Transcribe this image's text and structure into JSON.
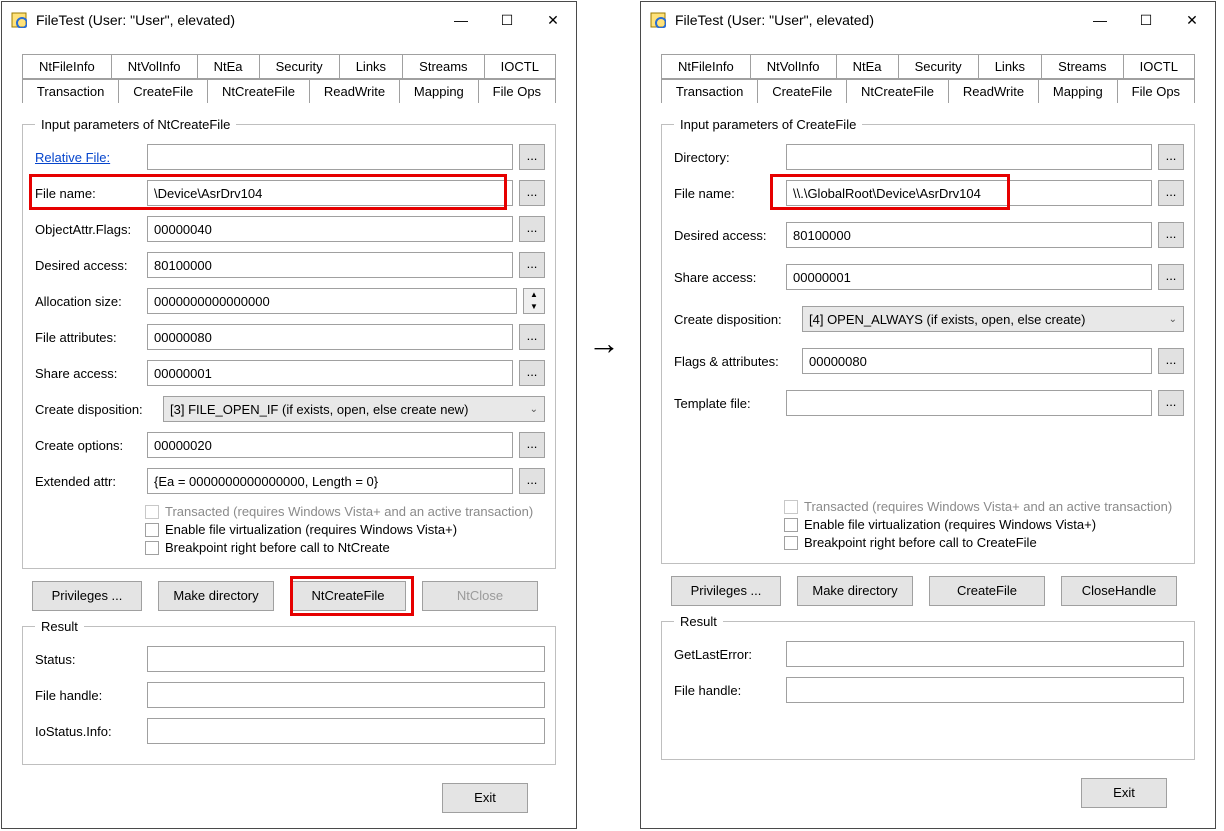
{
  "arrow": "→",
  "left": {
    "title": "FileTest (User: \"User\", elevated)",
    "tabs_row1": [
      "NtFileInfo",
      "NtVolInfo",
      "NtEa",
      "Security",
      "Links",
      "Streams",
      "IOCTL"
    ],
    "tabs_row2": [
      "Transaction",
      "CreateFile",
      "NtCreateFile",
      "ReadWrite",
      "Mapping",
      "File Ops"
    ],
    "active_tab": "NtCreateFile",
    "fieldset_title": "Input parameters of NtCreateFile",
    "labels": {
      "relative_file": "Relative File:",
      "file_name": "File name:",
      "object_flags": "ObjectAttr.Flags:",
      "desired_access": "Desired access:",
      "allocation_size": "Allocation size:",
      "file_attributes": "File attributes:",
      "share_access": "Share access:",
      "create_disposition": "Create disposition:",
      "create_options": "Create options:",
      "extended_attr": "Extended attr:"
    },
    "values": {
      "relative_file": "",
      "file_name": "\\Device\\AsrDrv104",
      "object_flags": "00000040",
      "desired_access": "80100000",
      "allocation_size": "0000000000000000",
      "file_attributes": "00000080",
      "share_access": "00000001",
      "create_disposition": "[3] FILE_OPEN_IF (if exists, open, else create new)",
      "create_options": "00000020",
      "extended_attr": "{Ea = 0000000000000000, Length = 0}"
    },
    "checks": {
      "transacted": "Transacted (requires Windows Vista+ and an active transaction)",
      "virtualization": "Enable file virtualization (requires Windows Vista+)",
      "breakpoint": "Breakpoint right before call to NtCreate"
    },
    "buttons": {
      "privileges": "Privileges ...",
      "makedir": "Make directory",
      "action": "NtCreateFile",
      "close": "NtClose"
    },
    "result_title": "Result",
    "result_labels": {
      "status": "Status:",
      "file_handle": "File handle:",
      "iostatus": "IoStatus.Info:"
    },
    "exit": "Exit"
  },
  "right": {
    "title": "FileTest (User: \"User\", elevated)",
    "tabs_row1": [
      "NtFileInfo",
      "NtVolInfo",
      "NtEa",
      "Security",
      "Links",
      "Streams",
      "IOCTL"
    ],
    "tabs_row2": [
      "Transaction",
      "CreateFile",
      "NtCreateFile",
      "ReadWrite",
      "Mapping",
      "File Ops"
    ],
    "active_tab": "CreateFile",
    "fieldset_title": "Input parameters of CreateFile",
    "labels": {
      "directory": "Directory:",
      "file_name": "File name:",
      "desired_access": "Desired access:",
      "share_access": "Share access:",
      "create_disposition": "Create disposition:",
      "flags_attributes": "Flags & attributes:",
      "template_file": "Template file:"
    },
    "values": {
      "directory": "",
      "file_name": "\\\\.\\GlobalRoot\\Device\\AsrDrv104",
      "desired_access": "80100000",
      "share_access": "00000001",
      "create_disposition": "[4] OPEN_ALWAYS (if exists, open, else create)",
      "flags_attributes": "00000080",
      "template_file": ""
    },
    "checks": {
      "transacted": "Transacted (requires Windows Vista+ and an active transaction)",
      "virtualization": "Enable file virtualization (requires Windows Vista+)",
      "breakpoint": "Breakpoint right before call to CreateFile"
    },
    "buttons": {
      "privileges": "Privileges ...",
      "makedir": "Make directory",
      "action": "CreateFile",
      "close": "CloseHandle"
    },
    "result_title": "Result",
    "result_labels": {
      "getlasterror": "GetLastError:",
      "file_handle": "File handle:"
    },
    "exit": "Exit"
  },
  "icons": {
    "dots": "...",
    "minimize": "—",
    "maximize": "☐",
    "close": "✕",
    "chevron": "⌄"
  }
}
